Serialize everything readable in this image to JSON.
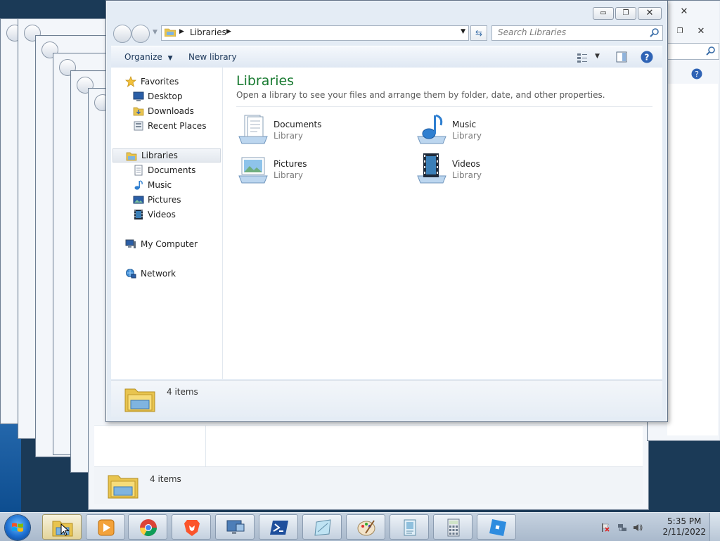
{
  "window": {
    "title_controls": {
      "minimize": "▭",
      "maximize": "❐",
      "close": "✕"
    },
    "address": {
      "crumb": "Libraries"
    },
    "search": {
      "placeholder": "Search Libraries"
    },
    "toolbar": {
      "organize": "Organize",
      "new_library": "New library"
    },
    "colors": {
      "accent_title": "#1a7b32",
      "selected_nav": "#e3e8ee"
    }
  },
  "sidebar": {
    "favorites": {
      "label": "Favorites",
      "items": [
        {
          "label": "Desktop",
          "icon": "desktop-icon"
        },
        {
          "label": "Downloads",
          "icon": "downloads-folder-icon"
        },
        {
          "label": "Recent Places",
          "icon": "recent-places-icon"
        }
      ]
    },
    "libraries": {
      "label": "Libraries",
      "items": [
        {
          "label": "Documents",
          "icon": "documents-icon"
        },
        {
          "label": "Music",
          "icon": "music-icon"
        },
        {
          "label": "Pictures",
          "icon": "pictures-icon"
        },
        {
          "label": "Videos",
          "icon": "videos-icon"
        }
      ]
    },
    "computer": {
      "label": "My Computer"
    },
    "network": {
      "label": "Network"
    }
  },
  "main": {
    "title": "Libraries",
    "subtitle": "Open a library to see your files and arrange them by folder, date, and other properties.",
    "libraries": [
      {
        "name": "Documents",
        "kind": "Library",
        "icon": "documents-library-icon"
      },
      {
        "name": "Music",
        "kind": "Library",
        "icon": "music-library-icon"
      },
      {
        "name": "Pictures",
        "kind": "Library",
        "icon": "pictures-library-icon"
      },
      {
        "name": "Videos",
        "kind": "Library",
        "icon": "videos-library-icon"
      }
    ]
  },
  "status": {
    "count": "4 items"
  },
  "background_window": {
    "status_count": "4 items"
  },
  "taskbar": {
    "clock_time": "5:35 PM",
    "clock_date": "2/11/2022",
    "pinned": [
      "explorer-icon",
      "media-player-icon",
      "chrome-icon",
      "brave-icon",
      "remote-desktop-icon",
      "powershell-icon",
      "sticky-notes-icon",
      "paint-icon",
      "file-viewer-icon",
      "calculator-icon",
      "roblox-icon"
    ]
  }
}
